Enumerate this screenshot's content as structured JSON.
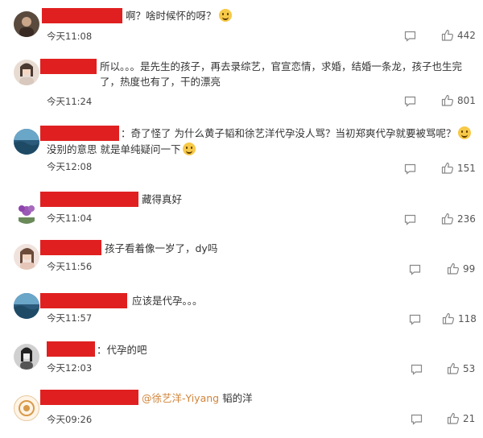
{
  "comments": [
    {
      "text": "啊？啥时候怀的呀？",
      "time": "今天11:08",
      "likes": "442"
    },
    {
      "text": "所以。。。是先生的孩子，再去录综艺，官宣恋情，求婚，结婚一条龙，孩子也生完了，热度也有了，干的漂亮",
      "time": "今天11:24",
      "likes": "801"
    },
    {
      "text": "：奇了怪了 为什么黄子韬和徐艺洋代孕没人骂？当初郑爽代孕就要被骂呢？",
      "text2": "没别的意思 就是单纯疑问一下",
      "time": "今天12:08",
      "likes": "151"
    },
    {
      "text": "藏得真好",
      "time": "今天11:04",
      "likes": "236"
    },
    {
      "text": "孩子看着像一岁了，dy吗",
      "time": "今天11:56",
      "likes": "99"
    },
    {
      "text": "应该是代孕。。。",
      "time": "今天11:57",
      "likes": "118"
    },
    {
      "text": "：代孕的吧",
      "time": "今天12:03",
      "likes": "53"
    },
    {
      "mention": "@徐艺洋-Yiyang",
      "text": "韬的洋",
      "time": "今天09:26",
      "likes": "21"
    }
  ],
  "icons": {
    "comment": "comment-icon",
    "like": "thumbs-up-icon",
    "emoji": "laughing-emoji-icon",
    "thinking": "thinking-emoji-icon"
  },
  "colors": {
    "redaction": "#e02020",
    "mention": "#d0843a",
    "text": "#333333",
    "icon": "#888888"
  }
}
